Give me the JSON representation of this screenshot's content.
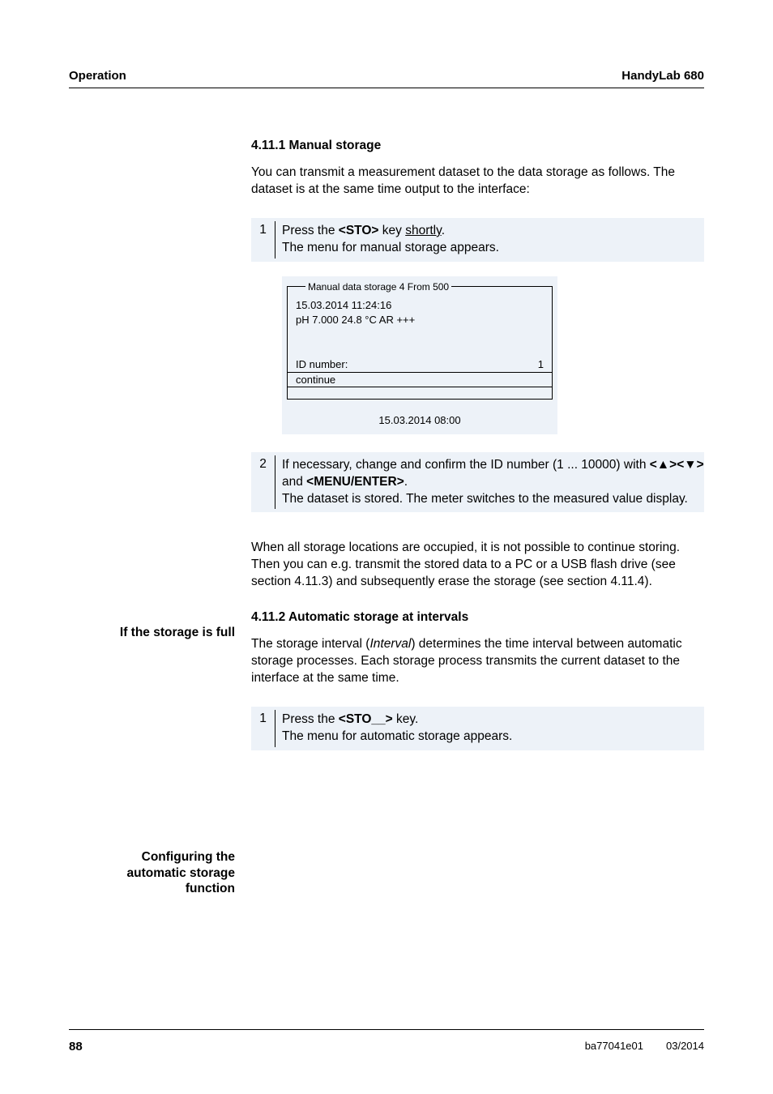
{
  "header": {
    "left": "Operation",
    "right": "HandyLab 680"
  },
  "section1": {
    "heading": "4.11.1 Manual storage",
    "intro": "You can transmit a measurement dataset to the data storage as follows. The dataset is at the same time output to the interface:",
    "step1": {
      "num": "1",
      "pre": "Press the ",
      "key": "<STO>",
      "mid": " key ",
      "u": "shortly",
      "post": ".",
      "line2": "The menu for manual storage appears."
    },
    "device": {
      "title": "Manual data storage 4 From 500",
      "l1": "15.03.2014  11:24:16",
      "l2": "pH 7.000    24.8 °C  AR  +++",
      "id_label": "ID number:",
      "id_value": "1",
      "continue": "continue",
      "bottom": "15.03.2014 08:00"
    },
    "step2": {
      "num": "2",
      "part1": "If necessary, change and confirm the ID number (1 ... 10000) with ",
      "key1": "<▲>",
      "key1b": "<▼>",
      "and": " and ",
      "key2": "<MENU/ENTER>",
      "dot": ".",
      "line2": "The dataset is stored. The meter switches to the measured value display."
    }
  },
  "section2": {
    "side": "If the storage is full",
    "para": "When all storage locations are occupied, it is not possible to continue storing. Then you can e.g. transmit the stored data to a PC or a USB flash drive (see section 4.11.3) and subsequently erase the storage (see section 4.11.4)."
  },
  "section3": {
    "heading": "4.11.2  Automatic storage at intervals",
    "para_a": "The storage interval (",
    "para_i": "Interval",
    "para_b": ") determines the time interval between automatic storage processes. Each storage process transmits the current dataset to the interface at the same time."
  },
  "section4": {
    "side1": "Configuring the",
    "side2": "automatic storage",
    "side3": "function",
    "step": {
      "num": "1",
      "pre": "Press the ",
      "key": "<STO__>",
      "post": " key.",
      "line2": "The menu for automatic storage appears."
    }
  },
  "footer": {
    "page": "88",
    "code": "ba77041e01",
    "date": "03/2014"
  }
}
